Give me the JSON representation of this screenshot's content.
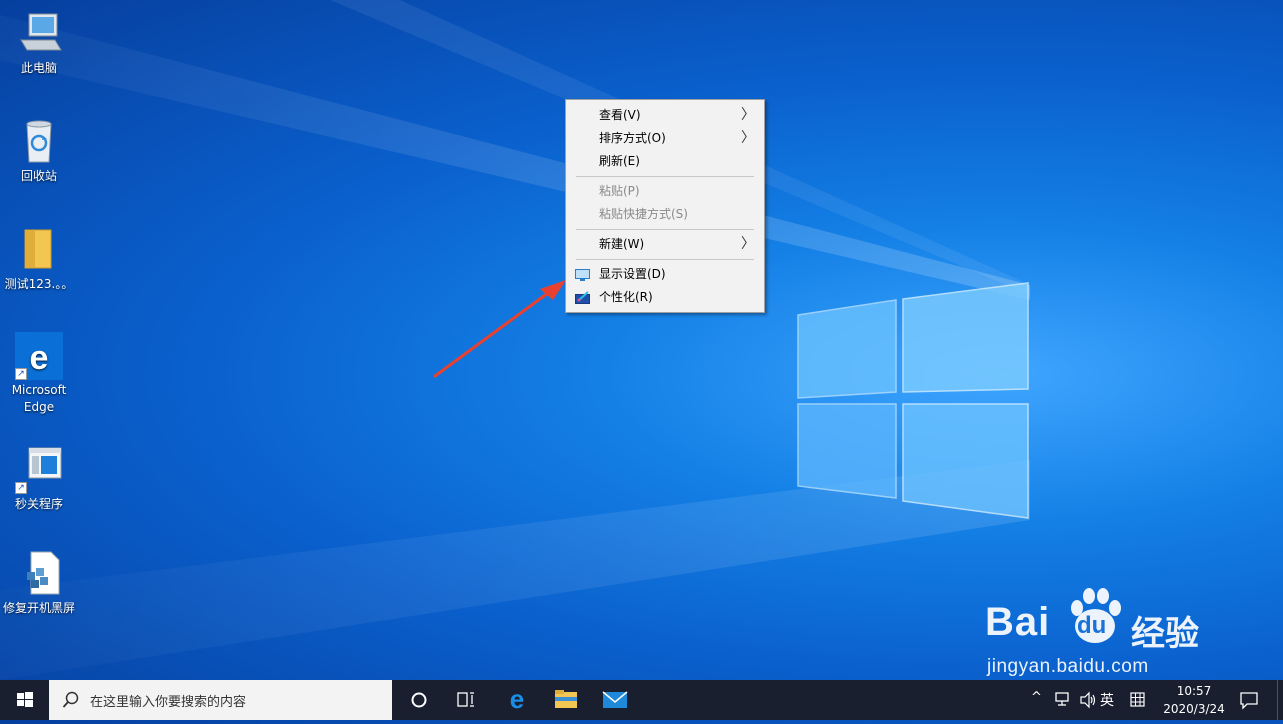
{
  "desktop_icons": [
    {
      "label": "此电脑",
      "icon": "computer-icon"
    },
    {
      "label": "回收站",
      "icon": "recycle-bin-icon"
    },
    {
      "label": "测试123.。。",
      "icon": "folder-icon"
    },
    {
      "label": "Microsoft Edge",
      "icon": "edge-icon"
    },
    {
      "label": "秒关程序",
      "icon": "program-window-icon"
    },
    {
      "label": "修复开机黑屏",
      "icon": "repair-file-icon"
    }
  ],
  "context_menu": {
    "items": [
      {
        "label": "查看(V)",
        "submenu": true,
        "disabled": false
      },
      {
        "label": "排序方式(O)",
        "submenu": true,
        "disabled": false
      },
      {
        "label": "刷新(E)",
        "submenu": false,
        "disabled": false
      },
      {
        "label": "粘贴(P)",
        "submenu": false,
        "disabled": true
      },
      {
        "label": "粘贴快捷方式(S)",
        "submenu": false,
        "disabled": true
      },
      {
        "label": "新建(W)",
        "submenu": true,
        "disabled": false
      },
      {
        "label": "显示设置(D)",
        "submenu": false,
        "disabled": false,
        "icon": "display-settings-icon"
      },
      {
        "label": "个性化(R)",
        "submenu": false,
        "disabled": false,
        "icon": "personalize-icon"
      }
    ],
    "submenu_glyph": "〉"
  },
  "taskbar": {
    "search_placeholder": "在这里输入你要搜索的内容",
    "pinned": [
      "cortana-icon",
      "task-view-icon",
      "edge-taskbar-icon",
      "file-explorer-icon",
      "mail-icon"
    ],
    "tray": {
      "chevron": "^",
      "ime_language": "英",
      "time": "10:57",
      "date": "2020/3/24"
    }
  },
  "watermark": {
    "brand": "Bai",
    "brand2": "du",
    "product": "经验",
    "url": "jingyan.baidu.com"
  },
  "colors": {
    "desktop": "#1480e6",
    "taskbar": "#191f2e",
    "menu_bg": "#f2f2f2",
    "arrow": "#e8412f"
  }
}
